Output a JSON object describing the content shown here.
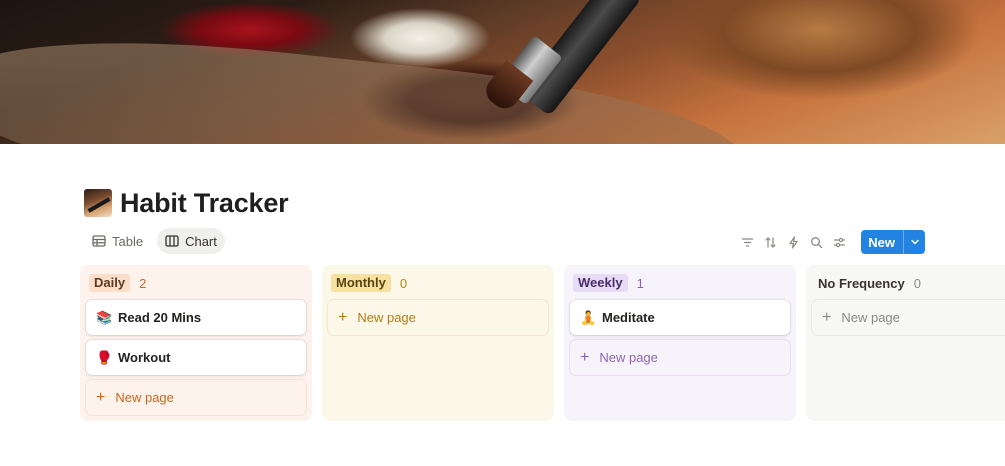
{
  "page": {
    "title": "Habit Tracker",
    "icon": "paintbrush-palette-icon"
  },
  "views": [
    {
      "label": "Table",
      "icon": "table-icon",
      "active": false
    },
    {
      "label": "Chart",
      "icon": "board-icon",
      "active": true
    }
  ],
  "toolbar": {
    "icons": [
      "filter-icon",
      "sort-icon",
      "automation-icon",
      "search-icon",
      "settings-icon"
    ],
    "new_label": "New"
  },
  "columns": [
    {
      "tag": "Daily",
      "count": "2",
      "color": "#fadec9",
      "cards": [
        {
          "emoji": "📚",
          "title": "Read 20 Mins"
        },
        {
          "emoji": "🥊",
          "title": "Workout"
        }
      ],
      "new_page_label": "New page"
    },
    {
      "tag": "Monthly",
      "count": "0",
      "color": "#f7e1a0",
      "cards": [],
      "new_page_label": "New page"
    },
    {
      "tag": "Weekly",
      "count": "1",
      "color": "#e8dbf5",
      "cards": [
        {
          "emoji": "🧘",
          "title": "Meditate"
        }
      ],
      "new_page_label": "New page"
    },
    {
      "tag": "No Frequency",
      "count": "0",
      "color": "#f7f7f5",
      "cards": [],
      "new_page_label": "New page"
    }
  ],
  "colors": {
    "accent": "#2383e2"
  }
}
